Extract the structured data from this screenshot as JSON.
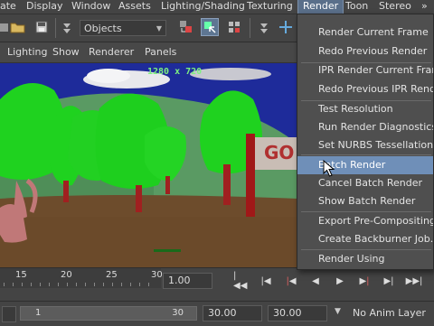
{
  "menubar": {
    "items": [
      "ate",
      "Display",
      "Window",
      "Assets",
      "Lighting/Shading",
      "Texturing",
      "Render",
      "Toon",
      "Stereo"
    ],
    "active": "Render",
    "overflow_glyph": "»"
  },
  "toolbar": {
    "object_selector": "Objects",
    "icons": [
      "open-folder",
      "save",
      "filter-menu",
      "select-by-hierarchy",
      "select-by-object-type",
      "select-by-component",
      "snap-grid",
      "transform"
    ]
  },
  "panel_menu": {
    "items": [
      "Lighting",
      "Show",
      "Renderer",
      "Panels"
    ]
  },
  "viewport": {
    "resolution_label": "1280 x 720",
    "sign_text": "GO"
  },
  "render_menu": {
    "items": [
      "Render Current Frame",
      "Redo Previous Render",
      "IPR Render Current Frame",
      "Redo Previous IPR Render",
      "Test Resolution",
      "Run Render Diagnostics",
      "Set NURBS Tessellation",
      "Batch Render",
      "Cancel Batch Render",
      "Show Batch Render",
      "Export Pre-Compositing",
      "Create Backburner Job...",
      "Render Using"
    ],
    "highlighted": "Batch Render"
  },
  "timeline": {
    "ticks": [
      "15",
      "20",
      "25",
      "30"
    ],
    "current_time": "1.00"
  },
  "range": {
    "slider_start": "1",
    "slider_end": "30",
    "end_time": "30.00",
    "playback_end": "30.00",
    "anim_layer": "No Anim Layer"
  },
  "colors": {
    "menu_highlight": "#6f8fb8",
    "background": "#444444",
    "sky": "#1e2b9a",
    "foliage": "#1fd21f"
  }
}
